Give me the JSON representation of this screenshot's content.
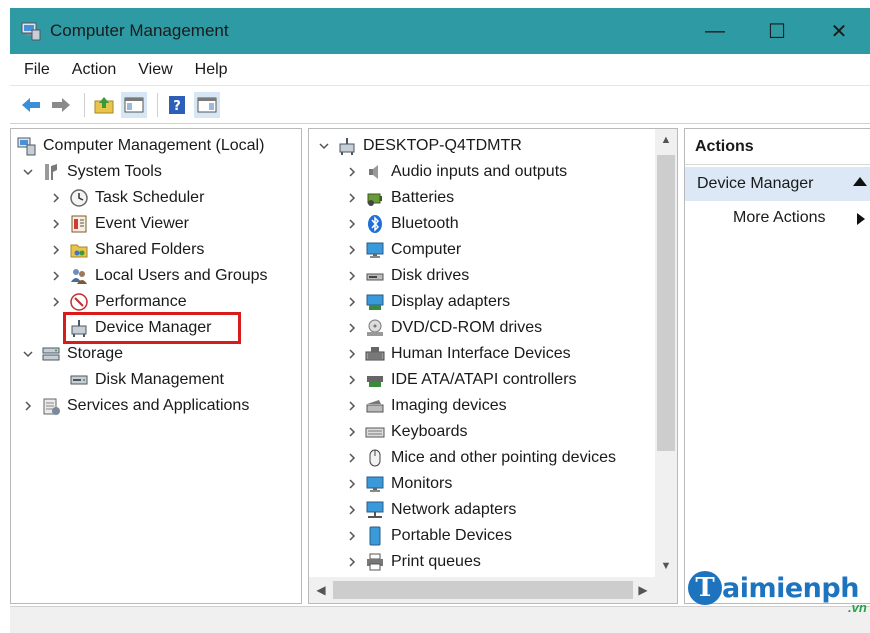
{
  "window": {
    "title": "Computer Management",
    "controls": {
      "minimize": "—",
      "maximize": "☐",
      "close": "✕"
    },
    "titlebar_color": "#2e9aa3"
  },
  "menu": {
    "file_label": "File",
    "action_label": "Action",
    "view_label": "View",
    "help_label": "Help"
  },
  "toolbar": {
    "icons": [
      "back-icon",
      "forward-icon",
      "up-folder-icon",
      "show-hide-console-tree-icon",
      "help-icon",
      "show-action-pane-icon"
    ]
  },
  "left_tree": {
    "root": "Computer Management (Local)",
    "system_tools": "System Tools",
    "task_scheduler": "Task Scheduler",
    "event_viewer": "Event Viewer",
    "shared_folders": "Shared Folders",
    "local_users": "Local Users and Groups",
    "performance": "Performance",
    "device_manager": "Device Manager",
    "storage": "Storage",
    "disk_management": "Disk Management",
    "services": "Services and Applications",
    "highlight_color": "#d81c1c"
  },
  "device_tree": {
    "root": "DESKTOP-Q4TDMTR",
    "items": [
      "Audio inputs and outputs",
      "Batteries",
      "Bluetooth",
      "Computer",
      "Disk drives",
      "Display adapters",
      "DVD/CD-ROM drives",
      "Human Interface Devices",
      "IDE ATA/ATAPI controllers",
      "Imaging devices",
      "Keyboards",
      "Mice and other pointing devices",
      "Monitors",
      "Network adapters",
      "Portable Devices",
      "Print queues"
    ]
  },
  "actions": {
    "header": "Actions",
    "section": "Device Manager",
    "more": "More Actions",
    "section_color": "#dce8f6"
  },
  "watermark": {
    "initial": "T",
    "text": "aimienph",
    "sub": ".vn"
  }
}
